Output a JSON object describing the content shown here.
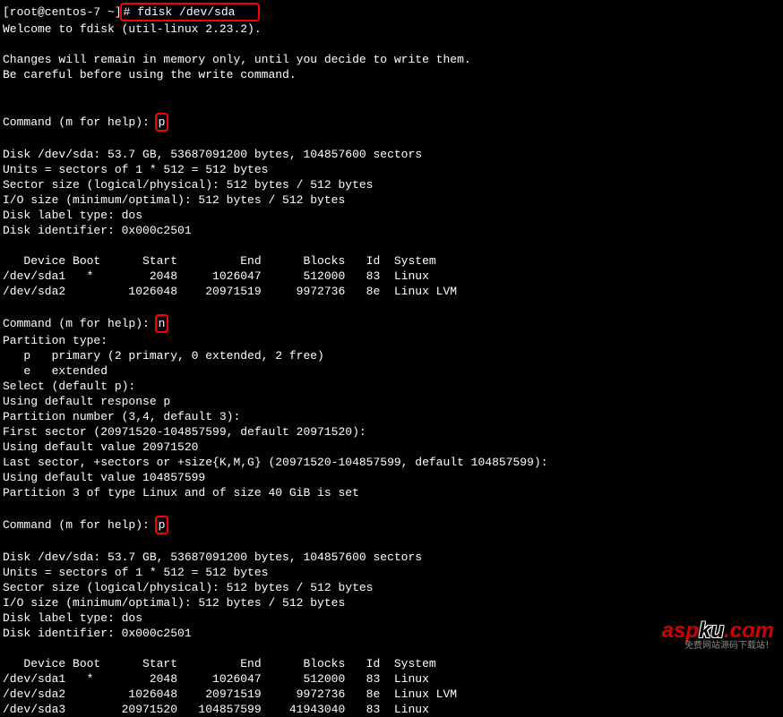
{
  "prompt_prefix": "[root@centos-7 ~]",
  "prompt_cmd": "# fdisk /dev/sda   ",
  "welcome": "Welcome to fdisk (util-linux 2.23.2).",
  "warning1": "Changes will remain in memory only, until you decide to write them.",
  "warning2": "Be careful before using the write command.",
  "cmd_prompt": "Command (m for help): ",
  "input_p1": "p",
  "disk_header": "Disk /dev/sda: 53.7 GB, 53687091200 bytes, 104857600 sectors",
  "units": "Units = sectors of 1 * 512 = 512 bytes",
  "sector_size": "Sector size (logical/physical): 512 bytes / 512 bytes",
  "io_size": "I/O size (minimum/optimal): 512 bytes / 512 bytes",
  "disk_label": "Disk label type: dos",
  "disk_id": "Disk identifier: 0x000c2501",
  "table_header": "   Device Boot      Start         End      Blocks   Id  System",
  "row_sda1": "/dev/sda1   *        2048     1026047      512000   83  Linux",
  "row_sda2": "/dev/sda2         1026048    20971519     9972736   8e  Linux LVM",
  "input_n": "n",
  "ptype_header": "Partition type:",
  "ptype_p": "   p   primary (2 primary, 0 extended, 2 free)",
  "ptype_e": "   e   extended",
  "select_default": "Select (default p):",
  "default_response": "Using default response p",
  "partition_num": "Partition number (3,4, default 3):",
  "first_sector": "First sector (20971520-104857599, default 20971520):",
  "default_val1": "Using default value 20971520",
  "last_sector": "Last sector, +sectors or +size{K,M,G} (20971520-104857599, default 104857599):",
  "default_val2": "Using default value 104857599",
  "partition_set": "Partition 3 of type Linux and of size 40 GiB is set",
  "input_p2": "p",
  "row_sda3": "/dev/sda3        20971520   104857599    41943040   83  Linux",
  "watermark_red": "asp",
  "watermark_black": "ku",
  "watermark_com": ".com",
  "watermark_sub": "免费网站源码下载站！"
}
